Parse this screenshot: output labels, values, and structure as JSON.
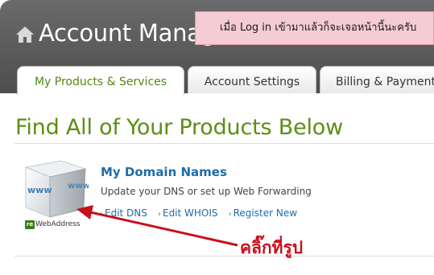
{
  "header": {
    "title": "Account Manag",
    "home_icon": "home-icon"
  },
  "callout": {
    "text": "เมื่อ Log in เข้ามาแล้วก็จะเจอหน้านี้นะครับ"
  },
  "tabs": [
    {
      "label": "My Products & Services",
      "active": true
    },
    {
      "label": "Account Settings",
      "active": false
    },
    {
      "label": "Billing & Payment",
      "active": false
    }
  ],
  "main": {
    "heading": "Find All of Your Products Below"
  },
  "product": {
    "image_text": "www",
    "brand": "WebAddress",
    "brand_badge": "re",
    "title": "My Domain Names",
    "description": "Update your DNS or set up Web Forwarding",
    "links": [
      "Edit DNS",
      "Edit WHOIS",
      "Register New"
    ]
  },
  "annotation": {
    "text": "คลิ๊กที่รูป"
  },
  "colors": {
    "header_bg": "#5a5a5a",
    "accent_green": "#5a8f16",
    "link_blue": "#1d6ca8",
    "annotation_red": "#c8101b",
    "callout_bg": "#f5cbd4"
  }
}
